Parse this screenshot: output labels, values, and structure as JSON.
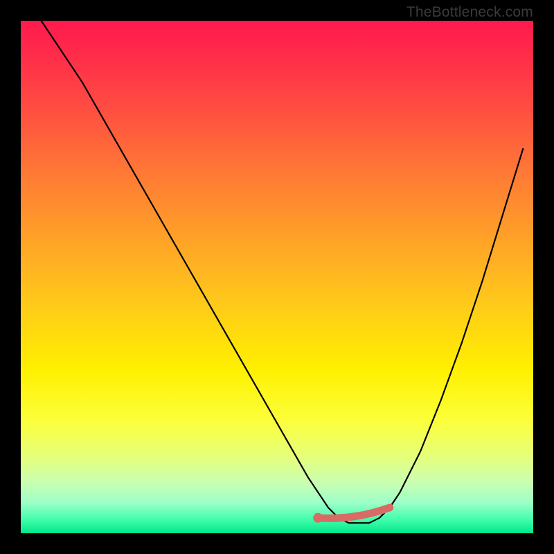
{
  "watermark": "TheBottleneck.com",
  "colors": {
    "background": "#000000",
    "curve": "#000000",
    "optimal_stroke": "#d86b64",
    "optimal_dot": "#d86b64",
    "gradient_top": "#ff1a4d",
    "gradient_bottom": "#00e88a"
  },
  "chart_data": {
    "type": "line",
    "title": "",
    "xlabel": "",
    "ylabel": "",
    "xlim": [
      0,
      100
    ],
    "ylim": [
      0,
      100
    ],
    "grid": false,
    "legend": false,
    "series": [
      {
        "name": "bottleneck-curve",
        "x": [
          4,
          8,
          12,
          16,
          20,
          24,
          28,
          32,
          36,
          40,
          44,
          48,
          52,
          56,
          58,
          60,
          62,
          64,
          66,
          68,
          70,
          72,
          74,
          78,
          82,
          86,
          90,
          94,
          98
        ],
        "values": [
          100,
          94,
          88,
          81,
          74,
          67,
          60,
          53,
          46,
          39,
          32,
          25,
          18,
          11,
          8,
          5,
          3,
          2,
          2,
          2,
          3,
          5,
          8,
          16,
          26,
          37,
          49,
          62,
          75
        ]
      }
    ],
    "optimal_range": {
      "x_start": 58,
      "x_end": 72,
      "y": 3
    },
    "optimal_dot": {
      "x": 58,
      "y": 3
    }
  }
}
